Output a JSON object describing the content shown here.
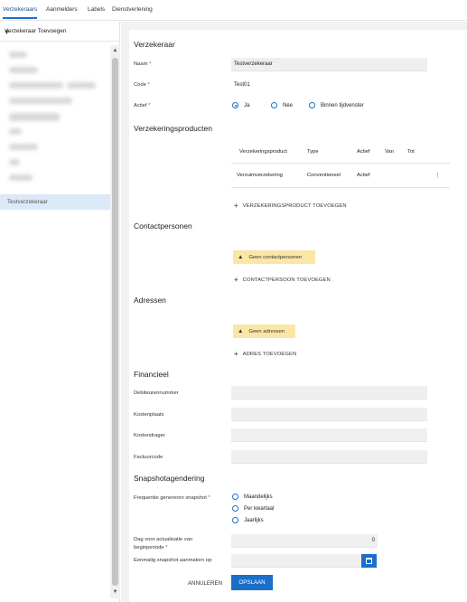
{
  "tabs": [
    "Verzekeraars",
    "Aanmelders",
    "Labels",
    "Dienstverlening"
  ],
  "sidebar": {
    "add_label": "Verzekeraar Toevoegen",
    "selected_item": "Testverzekeraar"
  },
  "form": {
    "title": "Verzekeraar",
    "naam_label": "Naam",
    "naam_value": "Testverzekeraar",
    "code_label": "Code",
    "code_value": "Test01",
    "actief_label": "Actief",
    "actief_options": [
      "Ja",
      "Nee",
      "Binnen tijdvenster"
    ],
    "actief_selected": "Ja"
  },
  "producten": {
    "title": "Verzekeringsproducten",
    "columns": [
      "Verzekeringsproduct",
      "Type",
      "Actief",
      "Van",
      "Tot"
    ],
    "rows": [
      [
        "Verzuimverzekering",
        "Conventioneel",
        "Actief",
        "",
        ""
      ]
    ],
    "add_label": "VERZEKERINGSPRODUCT TOEVOEGEN"
  },
  "contact": {
    "title": "Contactpersonen",
    "warning": "Geen contactpersonen",
    "add_label": "CONTACTPERSOON TOEVOEGEN"
  },
  "adressen": {
    "title": "Adressen",
    "warning": "Geen adressen",
    "add_label": "ADRES TOEVOEGEN"
  },
  "financieel": {
    "title": "Financieel",
    "fields": [
      "Debiteurennummer",
      "Kostenplaats",
      "Kostendrager",
      "Factuurcode"
    ]
  },
  "snapshot": {
    "title": "Snapshotagendering",
    "freq_label": "Frequentie genereren snapshot",
    "freq_options": [
      "Maandelijks",
      "Per kwartaal",
      "Jaarlijks"
    ],
    "dag_label_1": "Dag voor actualisatie van",
    "dag_label_2": "beginperiode",
    "dag_value": "0",
    "eenmalig_label": "Eenmalig snapshot aanmaken op:"
  },
  "actions": {
    "cancel": "ANNULEREN",
    "save": "OPSLAAN"
  },
  "colors": {
    "accent": "#1a6fc9",
    "warning_bg": "#fbe6a6",
    "selected_bg": "#dbe9f8"
  }
}
